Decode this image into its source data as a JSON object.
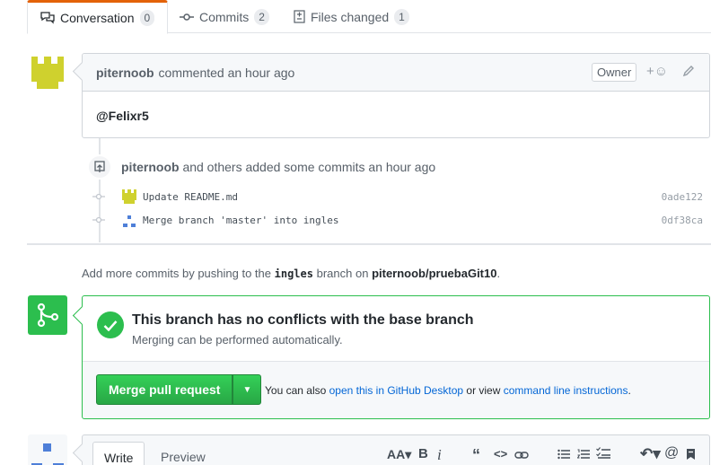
{
  "tabs": [
    {
      "label": "Conversation",
      "count": "0",
      "icon": "comment-discussion-icon"
    },
    {
      "label": "Commits",
      "count": "2",
      "icon": "git-commit-icon"
    },
    {
      "label": "Files changed",
      "count": "1",
      "icon": "diff-icon"
    }
  ],
  "comment": {
    "author": "piternoob",
    "meta": "commented an hour ago",
    "badge": "Owner",
    "reaction": "+☺",
    "body": "@Felixr5"
  },
  "commit_event": {
    "author": "piternoob",
    "text": "and others added some commits an hour ago",
    "commits": [
      {
        "message": "Update README.md",
        "sha": "0ade122"
      },
      {
        "message": "Merge branch 'master' into ingles",
        "sha": "0df38ca"
      }
    ]
  },
  "push_hint": {
    "prefix": "Add more commits by pushing to the",
    "branch": "ingles",
    "middle": "branch on",
    "repo": "piternoob/pruebaGit10",
    "suffix": "."
  },
  "merge": {
    "title": "This branch has no conflicts with the base branch",
    "subtitle": "Merging can be performed automatically.",
    "button": "Merge pull request",
    "help_prefix": "You can also",
    "help_link1": "open this in GitHub Desktop",
    "help_middle": "or view",
    "help_link2": "command line instructions",
    "help_suffix": ".",
    "colors": {
      "success": "#2cbe4e",
      "link": "#0366d6"
    }
  },
  "composer": {
    "write_tab": "Write",
    "preview_tab": "Preview",
    "tools": [
      "text-size-icon",
      "bold-icon",
      "italic-icon",
      "quote-icon",
      "code-icon",
      "link-icon",
      "bullet-list-icon",
      "numbered-list-icon",
      "task-list-icon",
      "reply-icon",
      "mention-icon",
      "bookmark-icon"
    ]
  }
}
